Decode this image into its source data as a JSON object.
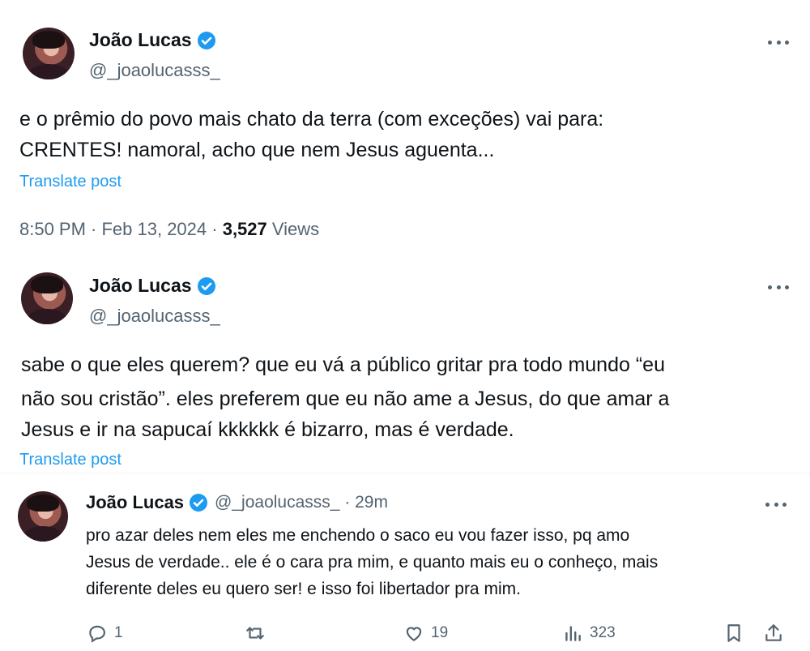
{
  "tweet1": {
    "name": "João Lucas",
    "handle": "@_joaolucasss_",
    "line1": "e o prêmio do povo mais chato da terra (com exceções) vai para:",
    "line2": "CRENTES! namoral, acho que nem Jesus aguenta...",
    "translate": "Translate post",
    "time": "8:50 PM · Feb 13, 2024 ·",
    "views_count": "3,527",
    "views_label": "Views"
  },
  "tweet2": {
    "name": "João Lucas",
    "handle": "@_joaolucasss_",
    "line1": "sabe o que eles querem? que eu vá a público gritar pra todo mundo “eu",
    "line2": "não sou cristão”. eles preferem que eu não ame a Jesus, do que amar a",
    "line3": "Jesus e ir na sapucaí kkkkkk é bizarro, mas é verdade.",
    "translate": "Translate post"
  },
  "reply": {
    "name": "João Lucas",
    "handle_time": "@_joaolucasss_ · 29m",
    "line1": "pro azar deles nem eles me enchendo o saco eu vou fazer isso, pq amo",
    "line2": "Jesus de verdade.. ele é o cara pra mim, e quanto mais eu o conheço, mais",
    "line3": "diferente deles eu quero ser! e isso foi libertador pra mim.",
    "replies": "1",
    "likes": "19",
    "views": "323"
  },
  "colors": {
    "accent": "#1d9bf0",
    "muted": "#536471",
    "text": "#0f1419"
  }
}
